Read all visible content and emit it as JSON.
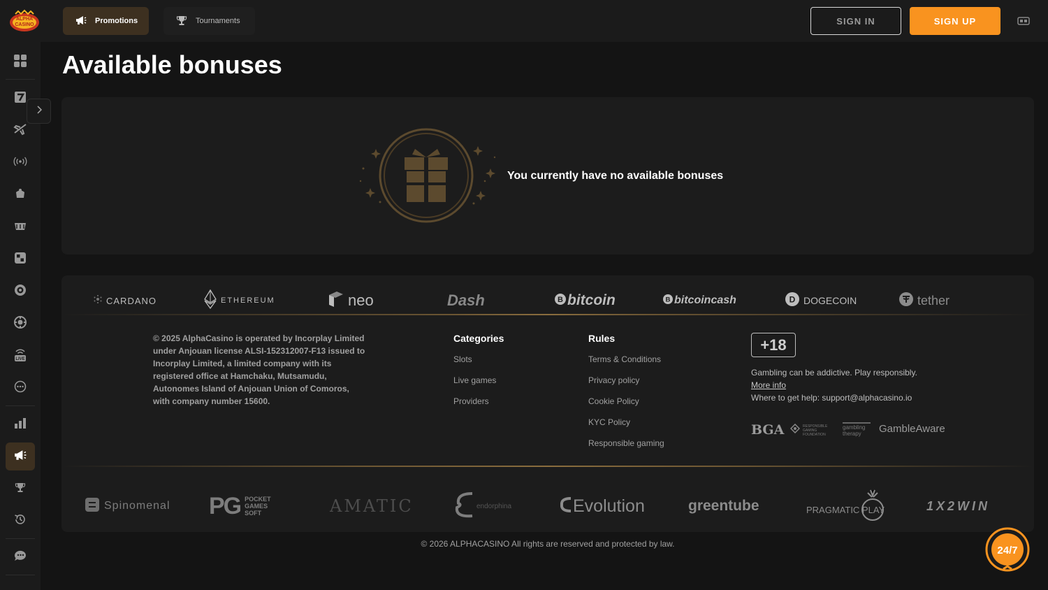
{
  "header": {
    "logo_text": "ALPHA CASINO",
    "promotions_label": "Promotions",
    "tournaments_label": "Tournaments",
    "signin_label": "SIGN IN",
    "signup_label": "SIGN UP"
  },
  "colors": {
    "accent": "#f9931f",
    "active_bg": "#3d3020",
    "gold": "#5c4a2e"
  },
  "page": {
    "title": "Available bonuses",
    "empty_message": "You currently have no available bonuses"
  },
  "sidebar": {
    "items": [
      {
        "name": "grid-icon"
      },
      {
        "name": "slot-seven-icon"
      },
      {
        "name": "plane-icon"
      },
      {
        "name": "live-signal-icon"
      },
      {
        "name": "cards-icon"
      },
      {
        "name": "basket-icon"
      },
      {
        "name": "dice-icon"
      },
      {
        "name": "roulette-icon"
      },
      {
        "name": "chip-icon"
      },
      {
        "name": "live-tv-icon"
      },
      {
        "name": "more-icon"
      },
      {
        "name": "stats-icon"
      },
      {
        "name": "megaphone-icon"
      },
      {
        "name": "trophy-icon"
      },
      {
        "name": "history-icon"
      },
      {
        "name": "chat-icon"
      }
    ]
  },
  "payments": [
    "CARDANO",
    "ETHEREUM",
    "neo",
    "Dash",
    "bitcoin",
    "bitcoincash",
    "DOGECOIN",
    "tether"
  ],
  "footer": {
    "legal": "© 2025 AlphaCasino is operated by Incorplay Limited under Anjouan license ALSI-152312007-F13 issued to Incorplay Limited, a limited company with its registered office at Hamchaku, Mutsamudu, Autonomes Island of Anjouan Union of Comoros, with company number 15600.",
    "categories_title": "Categories",
    "categories": [
      "Slots",
      "Live games",
      "Providers"
    ],
    "rules_title": "Rules",
    "rules": [
      "Terms & Conditions",
      "Privacy policy",
      "Cookie Policy",
      "KYC Policy",
      "Responsible gaming"
    ],
    "age": "+18",
    "responsible": "Gambling can be addictive. Play responsibly.",
    "more_info": "More info",
    "help": "Where to get help: support@alphacasino.io",
    "rg_logos": [
      "BGA",
      "RESPONSIBLE GAMING FOUNDATION",
      "gambling therapy",
      "GambleAware"
    ]
  },
  "providers": [
    "Spinomenal",
    "POCKET GAMES SOFT",
    "AMATIC",
    "endorphina",
    "Evolution",
    "greentube",
    "PRAGMATIC PLAY",
    "1X2WIN"
  ],
  "copyright": "© 2026 ALPHACASINO All rights are reserved and protected by law.",
  "support_label": "24/7"
}
